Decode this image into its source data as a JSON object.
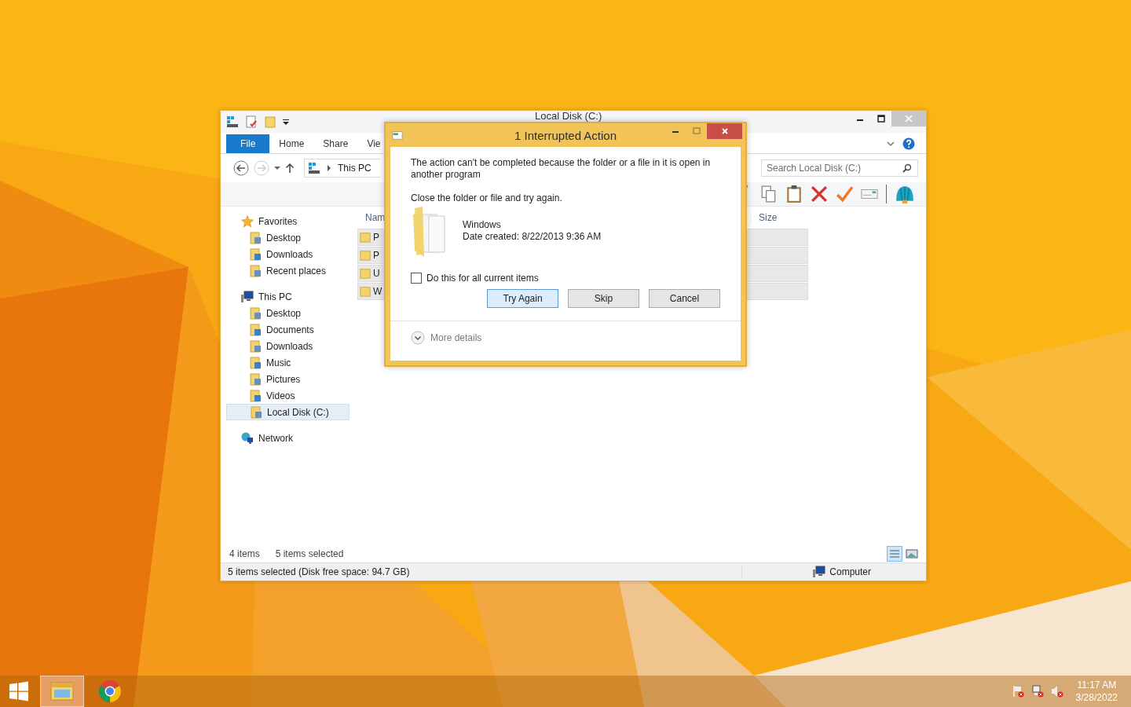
{
  "explorer": {
    "title": "Local Disk (C:)",
    "tabs": [
      {
        "label": "File",
        "selected": true
      },
      {
        "label": "Home",
        "selected": false
      },
      {
        "label": "Share",
        "selected": false
      },
      {
        "label": "Vie",
        "selected": false
      }
    ],
    "address": [
      "This PC"
    ],
    "search": {
      "placeholder": "Search Local Disk (C:)"
    },
    "columns": [
      "Nam",
      "Size"
    ],
    "rows": [
      {
        "name": "P",
        "selected": true
      },
      {
        "name": "P",
        "selected": true
      },
      {
        "name": "U",
        "selected": true
      },
      {
        "name": "W",
        "selected": true
      }
    ],
    "nav": [
      {
        "label": "Favorites",
        "selected": false,
        "children": [
          {
            "label": "Desktop",
            "selected": false
          },
          {
            "label": "Downloads",
            "selected": false
          },
          {
            "label": "Recent places",
            "selected": false
          }
        ]
      },
      {
        "label": "This PC",
        "selected": false,
        "children": [
          {
            "label": "Desktop",
            "selected": false
          },
          {
            "label": "Documents",
            "selected": false
          },
          {
            "label": "Downloads",
            "selected": false
          },
          {
            "label": "Music",
            "selected": false
          },
          {
            "label": "Pictures",
            "selected": false
          },
          {
            "label": "Videos",
            "selected": false
          },
          {
            "label": "Local Disk (C:)",
            "selected": true
          }
        ]
      },
      {
        "label": "Network",
        "selected": false
      }
    ],
    "item_count": "4 items",
    "selection_count": "5 items selected",
    "status_bar": {
      "text": "5 items selected (Disk free space: 94.7 GB)",
      "zone": "Computer"
    }
  },
  "dialog": {
    "title": "1 Interrupted Action",
    "message": "The action can't be completed because the folder or a file in it is open in another program",
    "instruction": "Close the folder or file and try again.",
    "file_name": "Windows",
    "file_date": "Date created: 8/22/2013 9:36 AM",
    "apply_all": {
      "label": "Do this for all current items",
      "checked": false
    },
    "buttons": [
      {
        "label": "Try Again",
        "default": true
      },
      {
        "label": "Skip",
        "default": false
      },
      {
        "label": "Cancel",
        "default": false
      }
    ],
    "more_details": "More details"
  },
  "taskbar": {
    "apps": [
      {
        "kind": "explorer",
        "active": true
      },
      {
        "kind": "chrome",
        "active": false
      }
    ],
    "time": "11:17 AM",
    "date": "3/28/2022"
  }
}
